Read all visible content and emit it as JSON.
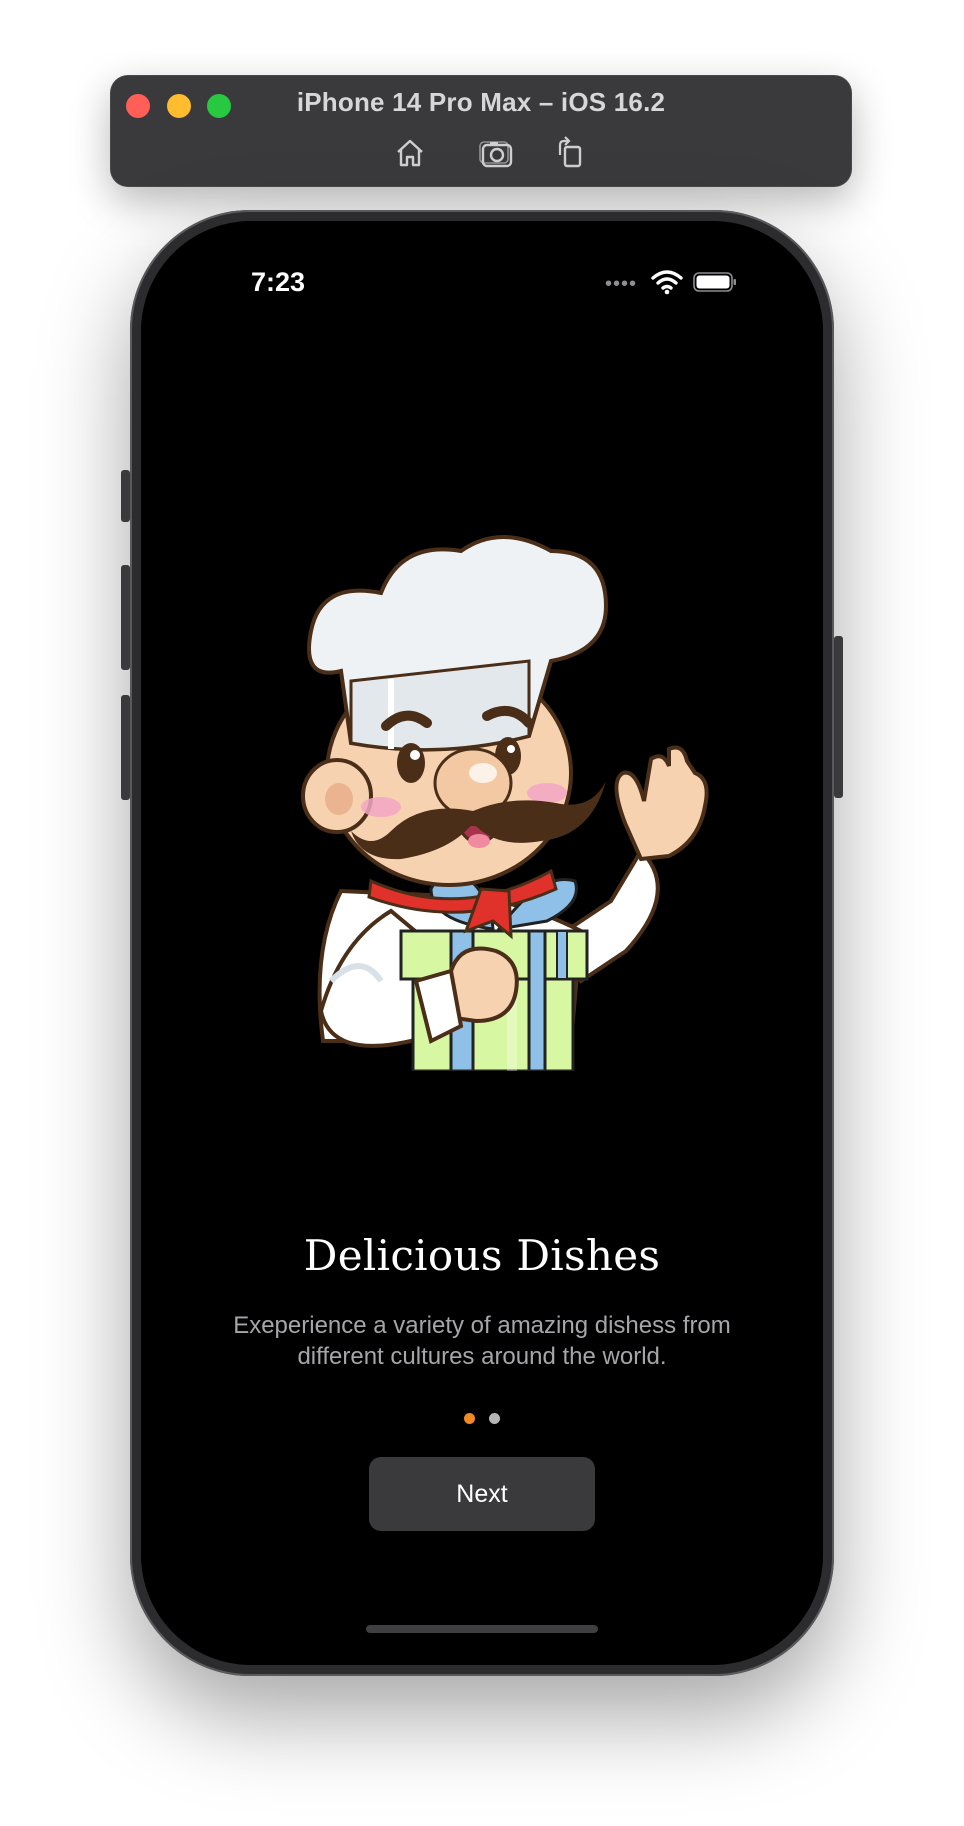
{
  "simulator": {
    "title": "iPhone 14 Pro Max – iOS 16.2",
    "tools": [
      "home-icon",
      "screenshot-icon",
      "rotate-icon"
    ]
  },
  "status_bar": {
    "time": "7:23",
    "icons": [
      "cellular-icon",
      "wifi-icon",
      "battery-icon"
    ]
  },
  "onboarding": {
    "illustration": "chef-with-gift-illustration",
    "title": "Delicious Dishes",
    "description_line1": "Exeperience a variety of amazing dishess from",
    "description_line2": "different cultures around the world.",
    "page_count": 2,
    "current_page": 1,
    "next_label": "Next"
  },
  "colors": {
    "background": "#000000",
    "button": "#3a3a3c",
    "active_dot": "#f08a24",
    "inactive_dot": "#b5b5b8"
  }
}
